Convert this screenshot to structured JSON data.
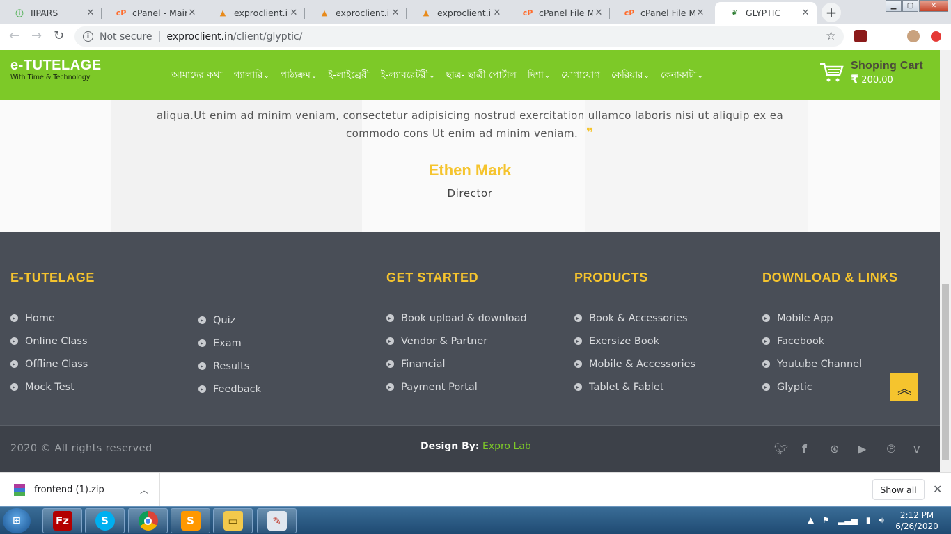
{
  "browser": {
    "tabs": [
      {
        "title": "IIPARS",
        "icon": "iipars-favicon"
      },
      {
        "title": "cPanel - Main",
        "icon": "cpanel-favicon"
      },
      {
        "title": "exproclient.in / ",
        "icon": "phpmyadmin-favicon"
      },
      {
        "title": "exproclient.in / ",
        "icon": "phpmyadmin-favicon"
      },
      {
        "title": "exproclient.in / ",
        "icon": "phpmyadmin-favicon"
      },
      {
        "title": "cPanel File Man",
        "icon": "cpanel-favicon"
      },
      {
        "title": "cPanel File Man",
        "icon": "cpanel-favicon"
      },
      {
        "title": "GLYPTIC",
        "icon": "glyptic-favicon",
        "active": true
      }
    ],
    "security": "Not secure",
    "url_host": "exproclient.in",
    "url_path": "/client/glyptic/"
  },
  "site": {
    "logo_title": "e-TUTELAGE",
    "logo_tagline": "With Time & Technology",
    "nav": [
      {
        "label": "আমাদের কথা",
        "dropdown": false
      },
      {
        "label": "গ্যালারি",
        "dropdown": true
      },
      {
        "label": "পাঠ্যক্রম",
        "dropdown": true
      },
      {
        "label": "ই-লাইব্রেরী",
        "dropdown": false
      },
      {
        "label": "ই-ল্যাবরেটরী",
        "dropdown": true
      },
      {
        "label": "ছাত্র- ছাত্রী পোর্টাল",
        "dropdown": false
      },
      {
        "label": "দিশা",
        "dropdown": true
      },
      {
        "label": "যোগাযোগ",
        "dropdown": false
      },
      {
        "label": "কেরিয়ার",
        "dropdown": true
      },
      {
        "label": "কেনাকাটা",
        "dropdown": true
      }
    ],
    "cart_label": "Shoping Cart",
    "cart_currency": "₹",
    "cart_value": "200.00"
  },
  "testimonial": {
    "line1": "aliqua.Ut enim ad minim veniam, consectetur adipisicing nostrud exercitation ullamco laboris nisi ut aliquip ex ea",
    "line2": "commodo cons Ut enim ad minim veniam.",
    "name": "Ethen Mark",
    "role": "Director"
  },
  "footer": {
    "col1_heading": "E-TUTELAGE",
    "col1_items": [
      "Home",
      "Online Class",
      "Offline Class",
      "Mock Test"
    ],
    "col1b_items": [
      "Quiz",
      "Exam",
      "Results",
      "Feedback"
    ],
    "col2_heading": "GET STARTED",
    "col2_items": [
      "Book upload & download",
      "Vendor & Partner",
      "Financial",
      "Payment Portal"
    ],
    "col3_heading": "PRODUCTS",
    "col3_items": [
      "Book & Accessories",
      "Exersize Book",
      "Mobile & Accessories",
      "Tablet & Fablet"
    ],
    "col4_heading": "DOWNLOAD & LINKS",
    "col4_items": [
      "Mobile App",
      "Facebook",
      "Youtube Channel",
      "Glyptic"
    ],
    "copyright": "2020 © All rights reserved",
    "design_by": "Design By:",
    "design_by_name": "Expro Lab",
    "social": [
      "twitter-icon",
      "facebook-icon",
      "dribbble-icon",
      "youtube-icon",
      "pinterest-icon",
      "vimeo-icon"
    ]
  },
  "download_shelf": {
    "file": "frontend (1).zip",
    "show_all": "Show all"
  },
  "taskbar": {
    "apps": [
      "filezilla",
      "skype",
      "chrome",
      "sublime-text",
      "file-explorer",
      "paint"
    ],
    "time": "2:12 PM",
    "date": "6/26/2020"
  },
  "colors": {
    "brand_green": "#7dc928",
    "accent_yellow": "#f5c42e",
    "footer_bg": "#494e57"
  }
}
